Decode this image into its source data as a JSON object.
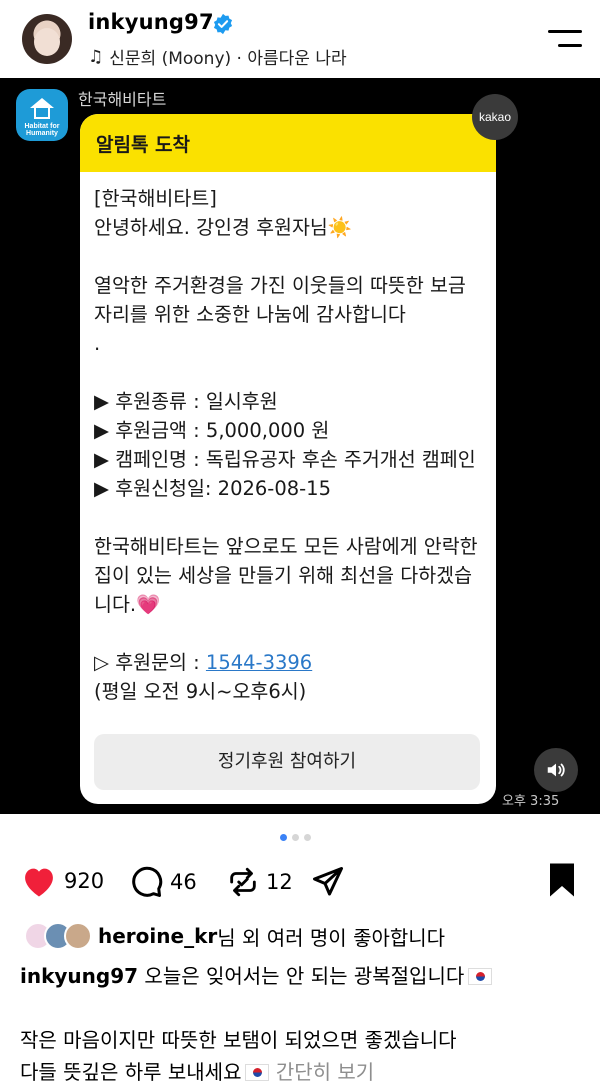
{
  "header": {
    "username": "inkyung97",
    "music": "신문희 (Moony) · 아름다운 나라"
  },
  "media": {
    "sender": "한국해비타트",
    "logo_text": "Habitat for Humanity",
    "kakao_badge": "kakao",
    "bubble_header": "알림톡 도착",
    "message_lines_1": "[한국해비타트]\n안녕하세요. 강인경 후원자님☀️\n\n열악한 주거환경을 가진 이웃들의 따뜻한 보금자리를 위한 소중한 나눔에 감사합니다\n.\n\n▶ 후원종류 : 일시후원\n▶ 후원금액 : 5,000,000 원\n▶ 캠페인명 : 독립유공자 후손 주거개선 캠페인\n▶ 후원신청일: 2026-08-15\n\n한국해비타트는 앞으로도 모든 사람에게 안락한 집이 있는 세상을 만들기 위해 최선을 다하겠습니다.💗\n\n",
    "inquiry_label": "▷ 후원문의 : ",
    "inquiry_phone": "1544-3396",
    "inquiry_hours": "\n(평일 오전 9시~오후6시)",
    "cta_label": "정기후원 참여하기",
    "timestamp": "오후 3:35"
  },
  "carousel": {
    "count": 3,
    "active_index": 0
  },
  "actions": {
    "likes": "920",
    "comments": "46",
    "reposts": "12"
  },
  "liked_by": {
    "user": "heroine_kr",
    "text": "님 외 여러 명이 좋아합니다"
  },
  "caption": {
    "username": "inkyung97",
    "line1": " 오늘은 잊어서는 안 되는 광복절입니다",
    "line2": "작은 마음이지만 따뜻한 보탬이 되었으면 좋겠습니다",
    "line3": "다들 뜻깊은 하루 보내세요",
    "more": " 간단히 보기"
  },
  "colors": {
    "accent_yellow": "#fae100",
    "like_red": "#f0203a",
    "verified_blue": "#1d9bf0",
    "link_blue": "#2a78c8",
    "active_dot": "#3b82f6"
  },
  "icons": [
    "verified-badge-icon",
    "music-note-icon",
    "menu-icon",
    "heart-icon",
    "comment-icon",
    "repost-icon",
    "share-icon",
    "bookmark-icon",
    "sound-icon",
    "flag-kr-icon"
  ]
}
